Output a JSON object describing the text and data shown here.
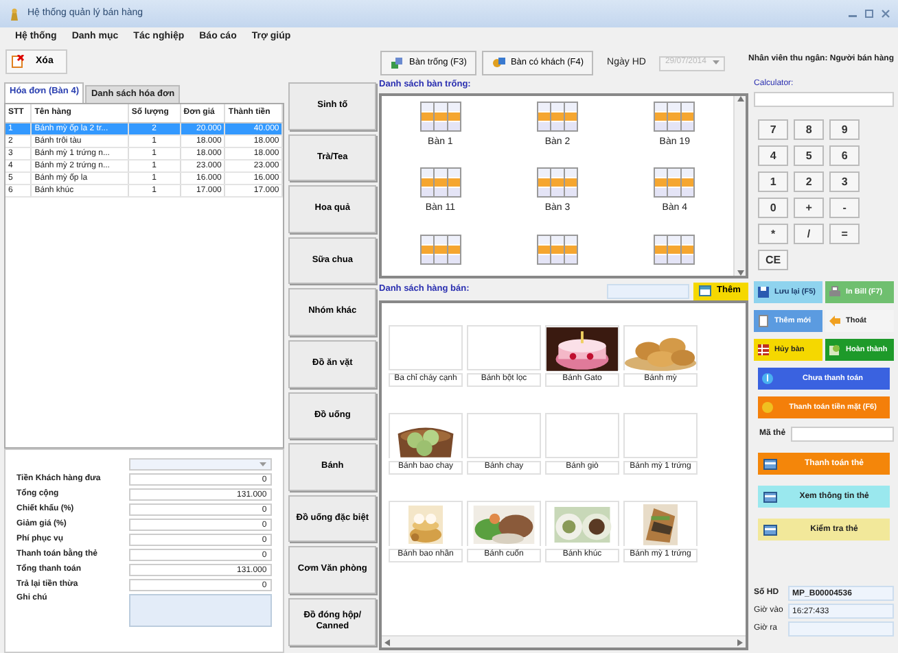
{
  "window": {
    "title": "Hệ thống quản lý bán hàng"
  },
  "menu": [
    "Hệ thống",
    "Danh mục",
    "Tác nghiệp",
    "Báo cáo",
    "Trợ giúp"
  ],
  "toolbar": {
    "delete_label": "Xóa"
  },
  "invoice_tabs": [
    {
      "label": "Hóa đơn (Bàn 4)",
      "selected": true
    },
    {
      "label": "Danh sách hóa đơn",
      "selected": false
    }
  ],
  "invoice": {
    "columns": [
      "STT",
      "Tên hàng",
      "Số lượng",
      "Đơn giá",
      "Thành tiền"
    ],
    "rows": [
      {
        "cells": [
          "1",
          "Bánh mỳ ốp la 2 tr...",
          "2",
          "20.000",
          "40.000"
        ],
        "selected": true
      },
      {
        "cells": [
          "2",
          "Bánh trôi tàu",
          "1",
          "18.000",
          "18.000"
        ],
        "selected": false
      },
      {
        "cells": [
          "3",
          "Bánh mỳ 1 trứng n...",
          "1",
          "18.000",
          "18.000"
        ],
        "selected": false
      },
      {
        "cells": [
          "4",
          "Bánh mỳ 2 trứng n...",
          "1",
          "23.000",
          "23.000"
        ],
        "selected": false
      },
      {
        "cells": [
          "5",
          "Bánh mỳ ốp la",
          "1",
          "16.000",
          "16.000"
        ],
        "selected": false
      },
      {
        "cells": [
          "6",
          "Bánh khúc",
          "1",
          "17.000",
          "17.000"
        ],
        "selected": false
      }
    ]
  },
  "summary": [
    {
      "label": "Tiền Khách hàng đưa",
      "value": "0"
    },
    {
      "label": "Tổng cộng",
      "value": "131.000"
    },
    {
      "label": "Chiết khấu (%)",
      "value": "0"
    },
    {
      "label": "Giảm giá (%)",
      "value": "0"
    },
    {
      "label": "Phí phục vụ",
      "value": "0"
    },
    {
      "label": "Thanh toán bằng thẻ",
      "value": "0"
    },
    {
      "label": "Tổng thanh toán",
      "value": "131.000"
    },
    {
      "label": "Trả lại tiền thừa",
      "value": "0"
    }
  ],
  "note_label": "Ghi chú",
  "categories": [
    "Sinh tố",
    "Trà/Tea",
    "Hoa quả",
    "Sữa chua",
    "Nhóm khác",
    "Đồ ăn vặt",
    "Đồ uống",
    "Bánh",
    "Đồ uống đặc biệt",
    "Cơm Văn phòng",
    "Đồ đóng hộp/ Canned"
  ],
  "table_buttons": [
    "Bàn trống (F3)",
    "Bàn có khách (F4)"
  ],
  "invoice_date": {
    "label": "Ngày HD",
    "value": "29/07/2014",
    "disabled": true
  },
  "tables_heading": "Danh sách bàn trống:",
  "tables": [
    "Bàn 1",
    "Bàn 2",
    "Bàn 19",
    "Bàn 11",
    "Bàn 3",
    "Bàn 4"
  ],
  "products_heading": "Danh sách hàng bán:",
  "add_button": "Thêm",
  "products": [
    {
      "name": "Ba chỉ cháy cạnh",
      "kind": "blank"
    },
    {
      "name": "Bánh bột lọc",
      "kind": "blank"
    },
    {
      "name": "Bánh Gato",
      "kind": "picture"
    },
    {
      "name": "Bánh mỳ",
      "kind": "picture"
    },
    {
      "name": "Bánh bao chay",
      "kind": "picture"
    },
    {
      "name": "Bánh chay",
      "kind": "blank"
    },
    {
      "name": "Bánh giò",
      "kind": "blank"
    },
    {
      "name": "Bánh mỳ 1 trứng",
      "kind": "blank"
    },
    {
      "name": "Bánh bao nhân",
      "kind": "picture"
    },
    {
      "name": "Bánh cuốn",
      "kind": "picture"
    },
    {
      "name": "Bánh khúc",
      "kind": "picture"
    },
    {
      "name": "Bánh mỳ 1 trứng",
      "kind": "picture"
    }
  ],
  "cashier": "Nhân viên thu ngân: Người bán hàng",
  "calculator": {
    "label": "Calculator:",
    "keys": [
      "7",
      "8",
      "9",
      "4",
      "5",
      "6",
      "1",
      "2",
      "3",
      "0",
      "+",
      "-",
      "*",
      "/",
      "=",
      "CE"
    ]
  },
  "actions": [
    {
      "label": "Lưu lại (F5)",
      "color": "#8fd3ee",
      "wide": false
    },
    {
      "label": "In Bill (F7)",
      "color": "#6fbf6f",
      "wide": false
    },
    {
      "label": "Thêm mới",
      "color": "#5b9be0",
      "wide": false
    },
    {
      "label": "Thoát",
      "color": "#f4f4f4",
      "wide": false
    },
    {
      "label": "Hủy bàn",
      "color": "#f5d800",
      "wide": false
    },
    {
      "label": "Hoàn thành",
      "color": "#1e9a2a",
      "wide": false
    },
    {
      "label": "Chưa thanh toán",
      "color": "#3a62e0",
      "wide": true
    },
    {
      "label": "Thanh toán tiền mặt (F6)",
      "color": "#f47f0a",
      "wide": true
    }
  ],
  "card_label": "Mã thẻ",
  "card_actions": [
    {
      "label": "Thanh toán thẻ",
      "color": "#f4860a"
    },
    {
      "label": "Xem thông tin thẻ",
      "color": "#9ae8ee"
    },
    {
      "label": "Kiểm tra thẻ",
      "color": "#f2e89a"
    }
  ],
  "bill_info": [
    {
      "label": "Số HD",
      "value": "MP_B00004536"
    },
    {
      "label": "Giờ vào",
      "value": "16:27:433"
    },
    {
      "label": "Giờ ra"
    }
  ]
}
